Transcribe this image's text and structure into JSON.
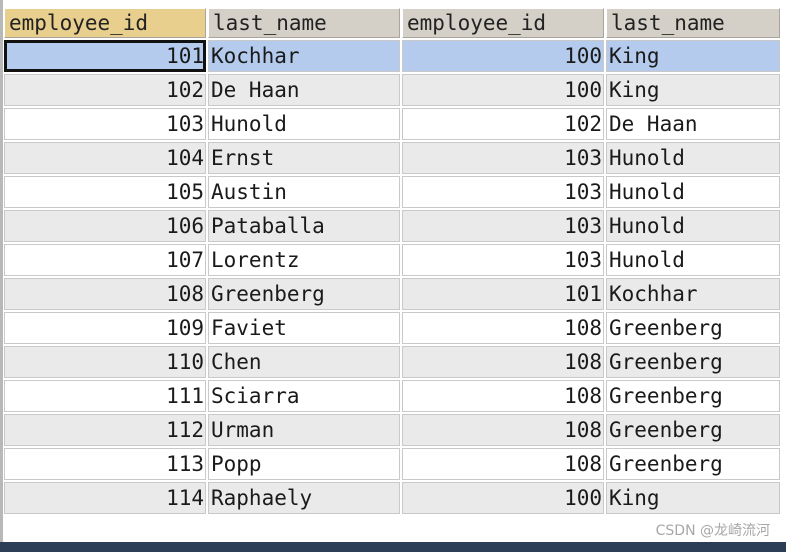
{
  "grid": {
    "columns": [
      "employee_id",
      "last_name",
      "employee_id",
      "last_name"
    ],
    "rows": [
      [
        "101",
        "Kochhar",
        "100",
        "King"
      ],
      [
        "102",
        "De Haan",
        "100",
        "King"
      ],
      [
        "103",
        "Hunold",
        "102",
        "De Haan"
      ],
      [
        "104",
        "Ernst",
        "103",
        "Hunold"
      ],
      [
        "105",
        "Austin",
        "103",
        "Hunold"
      ],
      [
        "106",
        "Pataballa",
        "103",
        "Hunold"
      ],
      [
        "107",
        "Lorentz",
        "103",
        "Hunold"
      ],
      [
        "108",
        "Greenberg",
        "101",
        "Kochhar"
      ],
      [
        "109",
        "Faviet",
        "108",
        "Greenberg"
      ],
      [
        "110",
        "Chen",
        "108",
        "Greenberg"
      ],
      [
        "111",
        "Sciarra",
        "108",
        "Greenberg"
      ],
      [
        "112",
        "Urman",
        "108",
        "Greenberg"
      ],
      [
        "113",
        "Popp",
        "108",
        "Greenberg"
      ],
      [
        "114",
        "Raphaely",
        "100",
        "King"
      ]
    ],
    "selected_row": 0,
    "focused_cell": [
      0,
      0
    ],
    "colors": {
      "header": "#d4d0c8",
      "header_selected": "#e8cf8e",
      "row_alt": "#eaeaea",
      "row_selected": "#b4cbee",
      "focus_border": "#111111"
    }
  },
  "watermark": "CSDN @龙崎流河"
}
